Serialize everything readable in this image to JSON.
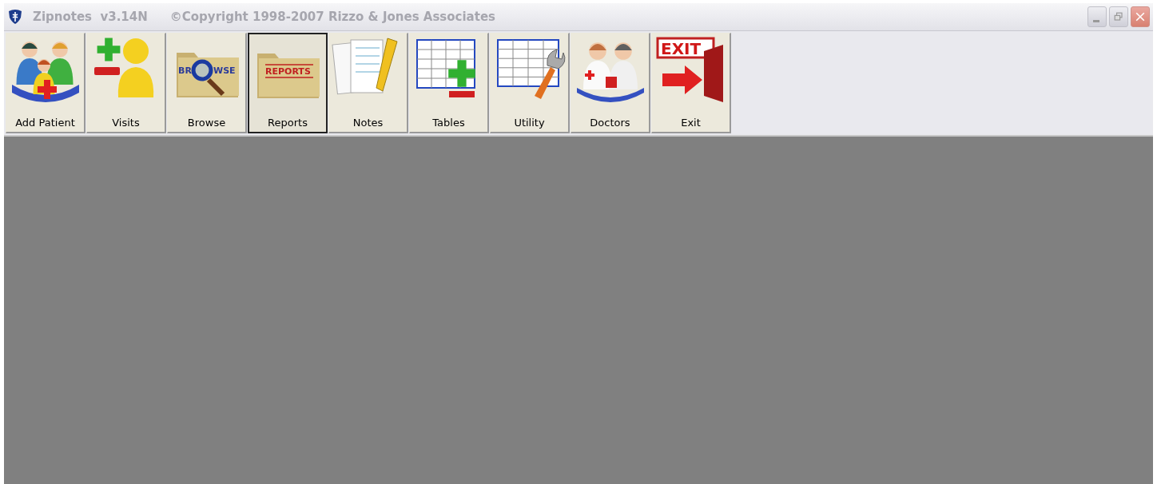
{
  "window": {
    "title": "Zipnotes  v3.14N",
    "copyright": "©Copyright 1998-2007 Rizzo & Jones Associates",
    "active": false
  },
  "toolbar": [
    {
      "label": "Add Patient",
      "selected": false
    },
    {
      "label": "Visits",
      "selected": false
    },
    {
      "label": "Browse",
      "selected": false,
      "icon_text": [
        "BR",
        "WSE"
      ]
    },
    {
      "label": "Reports",
      "selected": true,
      "icon_text": [
        "REPORTS"
      ]
    },
    {
      "label": "Notes",
      "selected": false
    },
    {
      "label": "Tables",
      "selected": false
    },
    {
      "label": "Utility",
      "selected": false
    },
    {
      "label": "Doctors",
      "selected": false
    },
    {
      "label": "Exit",
      "selected": false,
      "icon_text": [
        "EXIT"
      ]
    }
  ]
}
